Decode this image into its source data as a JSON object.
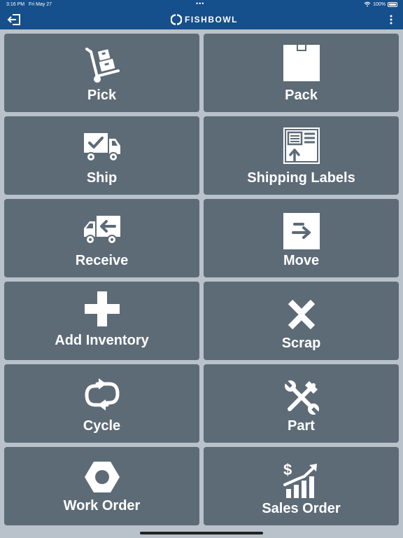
{
  "status": {
    "time": "3:16 PM",
    "date": "Fri May 27",
    "battery": "100%"
  },
  "app": {
    "brand": "FISHBOWL"
  },
  "tiles": [
    {
      "label": "Pick"
    },
    {
      "label": "Pack"
    },
    {
      "label": "Ship"
    },
    {
      "label": "Shipping Labels"
    },
    {
      "label": "Receive"
    },
    {
      "label": "Move"
    },
    {
      "label": "Add Inventory"
    },
    {
      "label": "Scrap"
    },
    {
      "label": "Cycle"
    },
    {
      "label": "Part"
    },
    {
      "label": "Work Order"
    },
    {
      "label": "Sales Order"
    }
  ],
  "icons": {
    "back": "logout-icon",
    "menu": "more-vertical-icon",
    "pick": "hand-truck-icon",
    "pack": "box-icon",
    "ship": "delivery-truck-check-icon",
    "labels": "shipping-label-icon",
    "receive": "truck-receive-icon",
    "move": "move-arrow-icon",
    "add": "plus-icon",
    "scrap": "x-icon",
    "cycle": "cycle-arrows-icon",
    "part": "tools-icon",
    "work": "hex-nut-icon",
    "sales": "sales-growth-icon"
  },
  "colors": {
    "header": "#154f8c",
    "tile": "#5d6b77",
    "background": "#b9c2cb"
  }
}
